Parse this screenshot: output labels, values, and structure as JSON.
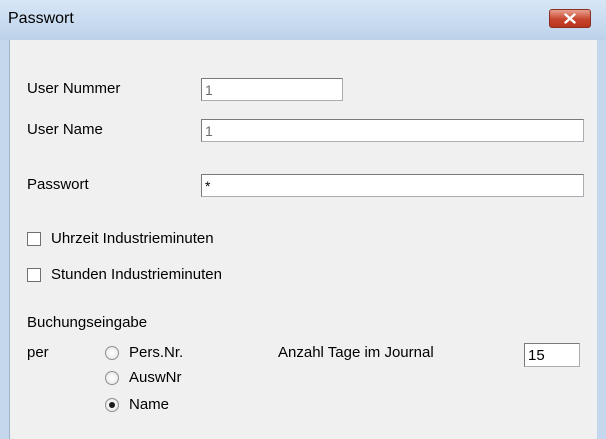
{
  "window": {
    "title": "Passwort",
    "close_icon": "close-icon"
  },
  "fields": {
    "user_nummer": {
      "label": "User Nummer",
      "value": "1"
    },
    "user_name": {
      "label": "User Name",
      "value": "1"
    },
    "passwort": {
      "label": "Passwort",
      "value": "*"
    }
  },
  "checkboxes": {
    "uhrzeit": {
      "label": "Uhrzeit Industrieminuten",
      "checked": false
    },
    "stunden": {
      "label": "Stunden Industrieminuten",
      "checked": false
    }
  },
  "buchung": {
    "title": "Buchungseingabe",
    "per_label": "per",
    "options": [
      {
        "label": "Pers.Nr.",
        "selected": false
      },
      {
        "label": "AuswNr",
        "selected": false
      },
      {
        "label": "Name",
        "selected": true
      }
    ]
  },
  "journal": {
    "label": "Anzahl Tage im Journal",
    "value": "15"
  },
  "colors": {
    "close_button": "#c7452d",
    "titlebar": "#c4d7ec"
  }
}
